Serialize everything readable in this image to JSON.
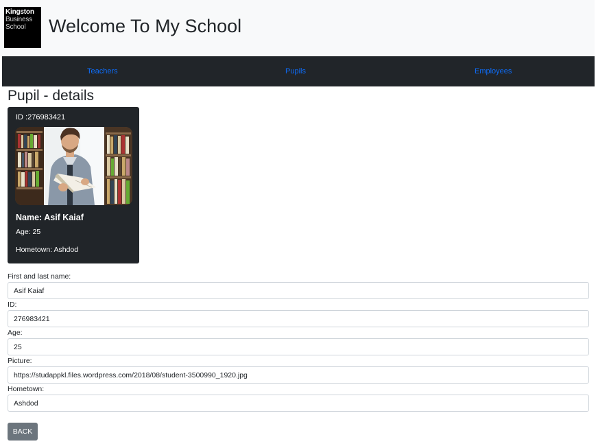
{
  "header": {
    "logo": {
      "line1": "Kingston",
      "line2": "Business",
      "line3": "School"
    },
    "title": "Welcome To My School"
  },
  "nav": {
    "items": [
      {
        "label": "Teachers"
      },
      {
        "label": "Pupils"
      },
      {
        "label": "Employees"
      }
    ]
  },
  "page": {
    "heading": "Pupil - details"
  },
  "card": {
    "id": "ID :276983421",
    "photo_icon": "student-photo",
    "name": "Name: Asif Kaiaf",
    "age": "Age: 25",
    "hometown": "Hometown: Ashdod"
  },
  "form": {
    "fields": [
      {
        "label": "First and last name:",
        "value": "Asif Kaiaf"
      },
      {
        "label": "ID:",
        "value": "276983421"
      },
      {
        "label": "Age:",
        "value": "25"
      },
      {
        "label": "Picture:",
        "value": "https://studappkl.files.wordpress.com/2018/08/student-3500990_1920.jpg"
      },
      {
        "label": "Hometown:",
        "value": "Ashdod"
      }
    ],
    "back_label": "BACK"
  },
  "colors": {
    "navbar": "#212529",
    "link": "#0d6efd",
    "card": "#212529",
    "back_button": "#6c757d",
    "header_bg": "#f8f9fa"
  }
}
